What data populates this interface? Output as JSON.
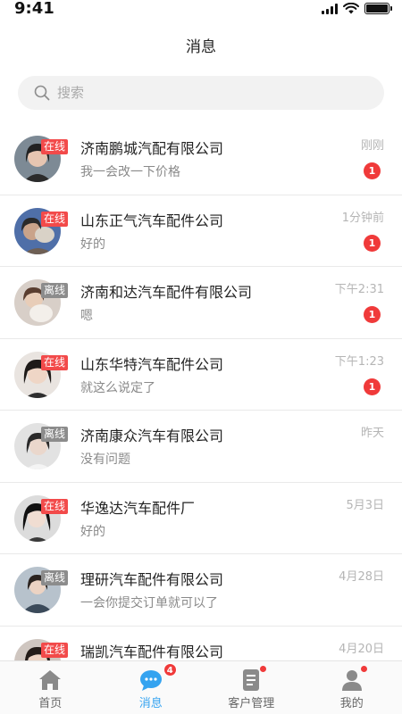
{
  "status_bar": {
    "time": "9:41"
  },
  "header": {
    "title": "消息"
  },
  "search": {
    "placeholder": "搜索",
    "value": ""
  },
  "conversations": [
    {
      "name": "济南鹏城汽配有限公司",
      "preview": "我一会改一下价格",
      "time": "刚刚",
      "status": "在线",
      "unread": "1"
    },
    {
      "name": "山东正气汽车配件公司",
      "preview": "好的",
      "time": "1分钟前",
      "status": "在线",
      "unread": "1"
    },
    {
      "name": "济南和达汽车配件有限公司",
      "preview": "嗯",
      "time": "下午2:31",
      "status": "离线",
      "unread": "1"
    },
    {
      "name": "山东华特汽车配件公司",
      "preview": "就这么说定了",
      "time": "下午1:23",
      "status": "在线",
      "unread": "1"
    },
    {
      "name": "济南康众汽车有限公司",
      "preview": "没有问题",
      "time": "昨天",
      "status": "离线",
      "unread": ""
    },
    {
      "name": "华逸达汽车配件厂",
      "preview": "好的",
      "time": "5月3日",
      "status": "在线",
      "unread": ""
    },
    {
      "name": "理研汽车配件有限公司",
      "preview": "一会你提交订单就可以了",
      "time": "4月28日",
      "status": "离线",
      "unread": ""
    },
    {
      "name": "瑞凯汽车配件有限公司",
      "preview": "",
      "time": "4月20日",
      "status": "在线",
      "unread": ""
    }
  ],
  "tab_bar": {
    "tabs": [
      {
        "label": "首页",
        "icon": "home-icon",
        "active": false
      },
      {
        "label": "消息",
        "icon": "chat-bubble-icon",
        "active": true,
        "badge": "4"
      },
      {
        "label": "客户管理",
        "icon": "document-icon",
        "active": false,
        "dot": true
      },
      {
        "label": "我的",
        "icon": "user-icon",
        "active": false,
        "dot": true
      }
    ]
  },
  "colors": {
    "accent": "#34a3f0",
    "online": "#f24a4a",
    "offline": "#8c8c8c",
    "badge": "#f03a3a"
  }
}
